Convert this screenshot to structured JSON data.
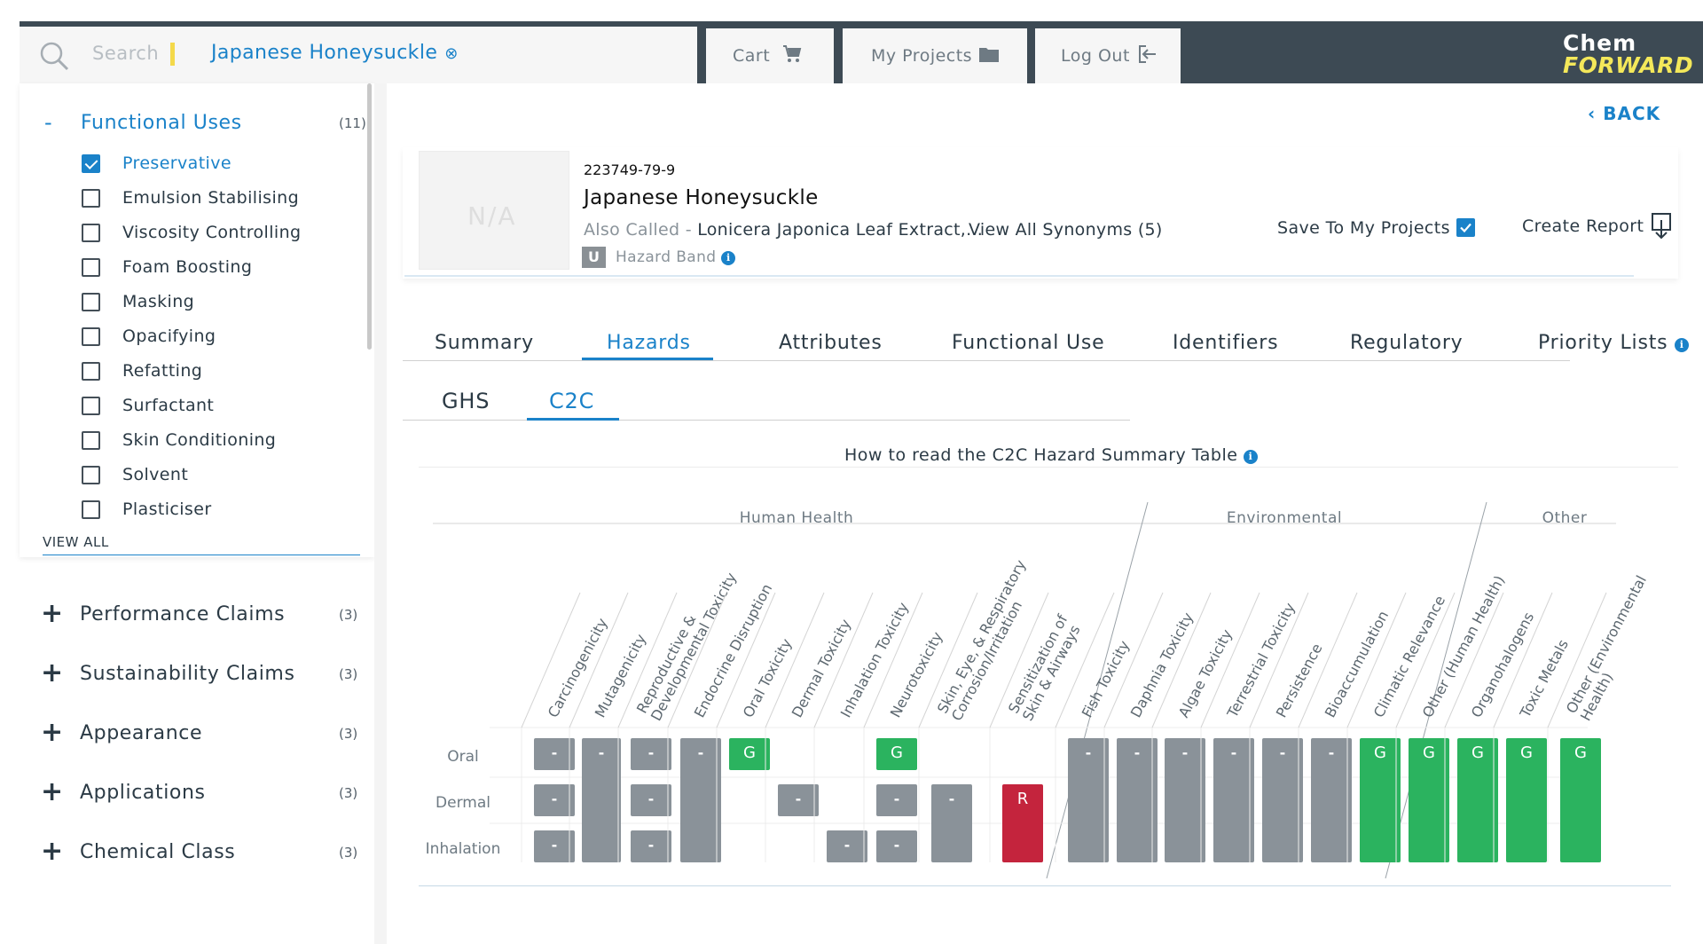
{
  "search": {
    "placeholder": "Search",
    "term": "Japanese Honeysuckle",
    "clear_glyph": "⊗"
  },
  "topnav": {
    "cart_label": "Cart",
    "projects_label": "My Projects",
    "logout_label": "Log Out"
  },
  "logo": {
    "line1": "Chem",
    "line2": "FORWARD"
  },
  "sidebar": {
    "functional_uses": {
      "toggle": "-",
      "title": "Functional Uses",
      "count": "(11)",
      "items": [
        {
          "label": "Preservative",
          "checked": true
        },
        {
          "label": "Emulsion Stabilising",
          "checked": false
        },
        {
          "label": "Viscosity Controlling",
          "checked": false
        },
        {
          "label": "Foam Boosting",
          "checked": false
        },
        {
          "label": "Masking",
          "checked": false
        },
        {
          "label": "Opacifying",
          "checked": false
        },
        {
          "label": "Refatting",
          "checked": false
        },
        {
          "label": "Surfactant",
          "checked": false
        },
        {
          "label": "Skin Conditioning",
          "checked": false
        },
        {
          "label": "Solvent",
          "checked": false
        },
        {
          "label": "Plasticiser",
          "checked": false
        }
      ],
      "view_all": "VIEW ALL"
    },
    "categories": [
      {
        "toggle": "+",
        "label": "Performance Claims",
        "count": "(3)"
      },
      {
        "toggle": "+",
        "label": "Sustainability Claims",
        "count": "(3)"
      },
      {
        "toggle": "+",
        "label": "Appearance",
        "count": "(3)"
      },
      {
        "toggle": "+",
        "label": "Applications",
        "count": "(3)"
      },
      {
        "toggle": "+",
        "label": "Chemical Class",
        "count": "(3)"
      }
    ]
  },
  "main": {
    "back_label": "BACK",
    "back_glyph": "‹",
    "chemical": {
      "image_placeholder": "N/A",
      "cas": "223749-79-9",
      "name": "Japanese Honeysuckle",
      "also_called_prefix": "Also Called - ",
      "also_called_value": "Lonicera Japonica Leaf Extract,...",
      "view_synonyms": "View All Synonyms (5)",
      "hazard_band_badge": "U",
      "hazard_band_label": "Hazard Band",
      "save_label": "Save To My Projects",
      "save_checked": true,
      "report_label": "Create Report"
    },
    "tabs": [
      {
        "label": "Summary",
        "active": false
      },
      {
        "label": "Hazards",
        "active": true
      },
      {
        "label": "Attributes",
        "active": false
      },
      {
        "label": "Functional Use",
        "active": false
      },
      {
        "label": "Identifiers",
        "active": false
      },
      {
        "label": "Regulatory",
        "active": false
      },
      {
        "label": "Priority Lists",
        "active": false
      }
    ],
    "subtabs": [
      {
        "label": "GHS",
        "active": false
      },
      {
        "label": "C2C",
        "active": true
      }
    ],
    "how_to_read": "How to read the C2C Hazard Summary Table",
    "info_glyph": "i"
  },
  "hazard_table": {
    "colors": {
      "grey": "#8a9299",
      "green": "#2bb35f",
      "red": "#c4243d"
    },
    "groups": [
      "Human Health",
      "Environmental",
      "Other"
    ],
    "rows": [
      "Oral",
      "Dermal",
      "Inhalation"
    ],
    "columns": [
      {
        "label": [
          "Carcinogenicity"
        ],
        "cells": [
          {
            "rating": "-",
            "color": "grey"
          },
          {
            "rating": "-",
            "color": "grey"
          },
          {
            "rating": "-",
            "color": "grey"
          }
        ]
      },
      {
        "label": [
          "Mutagenicity"
        ],
        "merged": {
          "rating": "-",
          "color": "grey"
        }
      },
      {
        "label": [
          "Reproductive &",
          "Developmental Toxicity"
        ],
        "cells": [
          {
            "rating": "-",
            "color": "grey"
          },
          {
            "rating": "-",
            "color": "grey"
          },
          {
            "rating": "-",
            "color": "grey"
          }
        ]
      },
      {
        "label": [
          "Endocrine Disruption"
        ],
        "merged": {
          "rating": "-",
          "color": "grey"
        }
      },
      {
        "label": [
          "Oral Toxicity"
        ],
        "cells": [
          {
            "rating": "G",
            "color": "green"
          },
          null,
          null
        ]
      },
      {
        "label": [
          "Dermal Toxicity"
        ],
        "cells": [
          null,
          {
            "rating": "-",
            "color": "grey"
          },
          null
        ]
      },
      {
        "label": [
          "Inhalation Toxicity"
        ],
        "cells": [
          null,
          null,
          {
            "rating": "-",
            "color": "grey"
          }
        ]
      },
      {
        "label": [
          "Neurotoxicity"
        ],
        "cells": [
          {
            "rating": "G",
            "color": "green"
          },
          {
            "rating": "-",
            "color": "grey"
          },
          {
            "rating": "-",
            "color": "grey"
          }
        ]
      },
      {
        "label": [
          "Skin, Eye, & Respiratory",
          "Corrosion/Irritation"
        ],
        "cells": [
          null,
          {
            "rating": "-",
            "color": "grey"
          },
          {
            "rating": "-",
            "color": "grey"
          }
        ]
      },
      {
        "label": [
          "Sensitization of",
          "Skin & Airways"
        ],
        "cells": [
          null,
          {
            "rating": "R",
            "color": "red"
          },
          {
            "rating": "R",
            "color": "red"
          }
        ]
      },
      {
        "label": [
          "Fish Toxicity"
        ],
        "merged": {
          "rating": "-",
          "color": "grey"
        }
      },
      {
        "label": [
          "Daphnia Toxicity"
        ],
        "merged": {
          "rating": "-",
          "color": "grey"
        }
      },
      {
        "label": [
          "Algae Toxicity"
        ],
        "merged": {
          "rating": "-",
          "color": "grey"
        }
      },
      {
        "label": [
          "Terrestrial Toxicity"
        ],
        "merged": {
          "rating": "-",
          "color": "grey"
        }
      },
      {
        "label": [
          "Persistence"
        ],
        "merged": {
          "rating": "-",
          "color": "grey"
        }
      },
      {
        "label": [
          "Bioaccumulation"
        ],
        "merged": {
          "rating": "-",
          "color": "grey"
        }
      },
      {
        "label": [
          "Climatic Relevance"
        ],
        "merged": {
          "rating": "G",
          "color": "green"
        }
      },
      {
        "label": [
          "Other (Human Health)"
        ],
        "merged": {
          "rating": "G",
          "color": "green"
        }
      },
      {
        "label": [
          "Organohalogens"
        ],
        "merged": {
          "rating": "G",
          "color": "green"
        }
      },
      {
        "label": [
          "Toxic Metals"
        ],
        "merged": {
          "rating": "G",
          "color": "green"
        }
      },
      {
        "label": [
          "Other (Environmental",
          "Health)"
        ],
        "merged": {
          "rating": "G",
          "color": "green"
        }
      }
    ]
  }
}
